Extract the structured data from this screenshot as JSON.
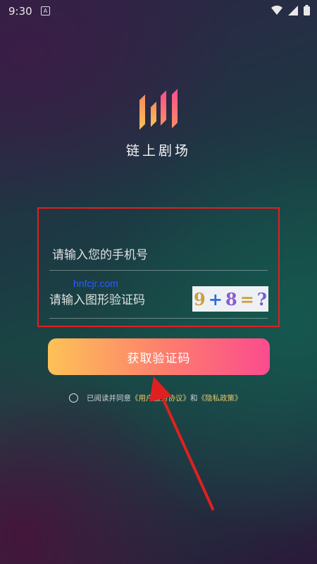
{
  "status_bar": {
    "time": "9:30",
    "notification_icon": "A"
  },
  "app": {
    "name": "链上剧场"
  },
  "form": {
    "phone_placeholder": "请输入您的手机号",
    "captcha_placeholder": "请输入图形验证码",
    "captcha_chars": [
      "9",
      "+",
      "8",
      "=",
      "?"
    ],
    "submit_label": "获取验证码"
  },
  "agreement": {
    "prefix": "已阅读并同意",
    "terms_link": "《用户服务协议》",
    "and": "和",
    "privacy_link": "《隐私政策》"
  },
  "watermark": "hnfcjr.com",
  "colors": {
    "highlight": "#e02020",
    "button_start": "#fdc257",
    "button_end": "#fb4c8f",
    "link": "#e8c66a"
  }
}
